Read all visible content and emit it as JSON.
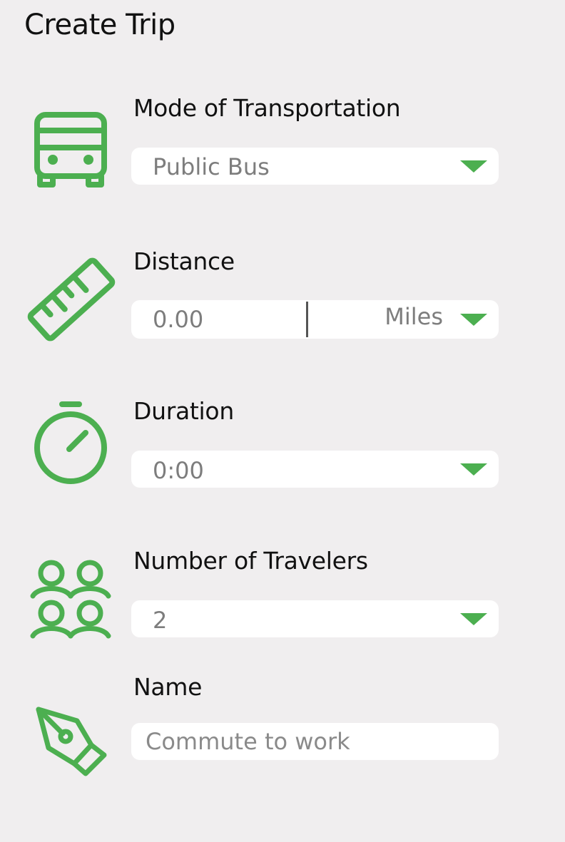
{
  "page": {
    "title": "Create Trip"
  },
  "form": {
    "mode": {
      "label": "Mode of Transportation",
      "value": "Public Bus",
      "icon": "bus-icon"
    },
    "distance": {
      "label": "Distance",
      "value": "0.00",
      "unit": "Miles",
      "icon": "ruler-icon"
    },
    "duration": {
      "label": "Duration",
      "value": "0:00",
      "icon": "stopwatch-icon"
    },
    "travelers": {
      "label": "Number of Travelers",
      "value": "2",
      "icon": "people-icon"
    },
    "name": {
      "label": "Name",
      "placeholder": "Commute to work",
      "icon": "pen-nib-icon"
    }
  },
  "colors": {
    "accent": "#4caf50",
    "background": "#f0eeef",
    "field": "#ffffff",
    "value_text": "#7d7d7d"
  }
}
